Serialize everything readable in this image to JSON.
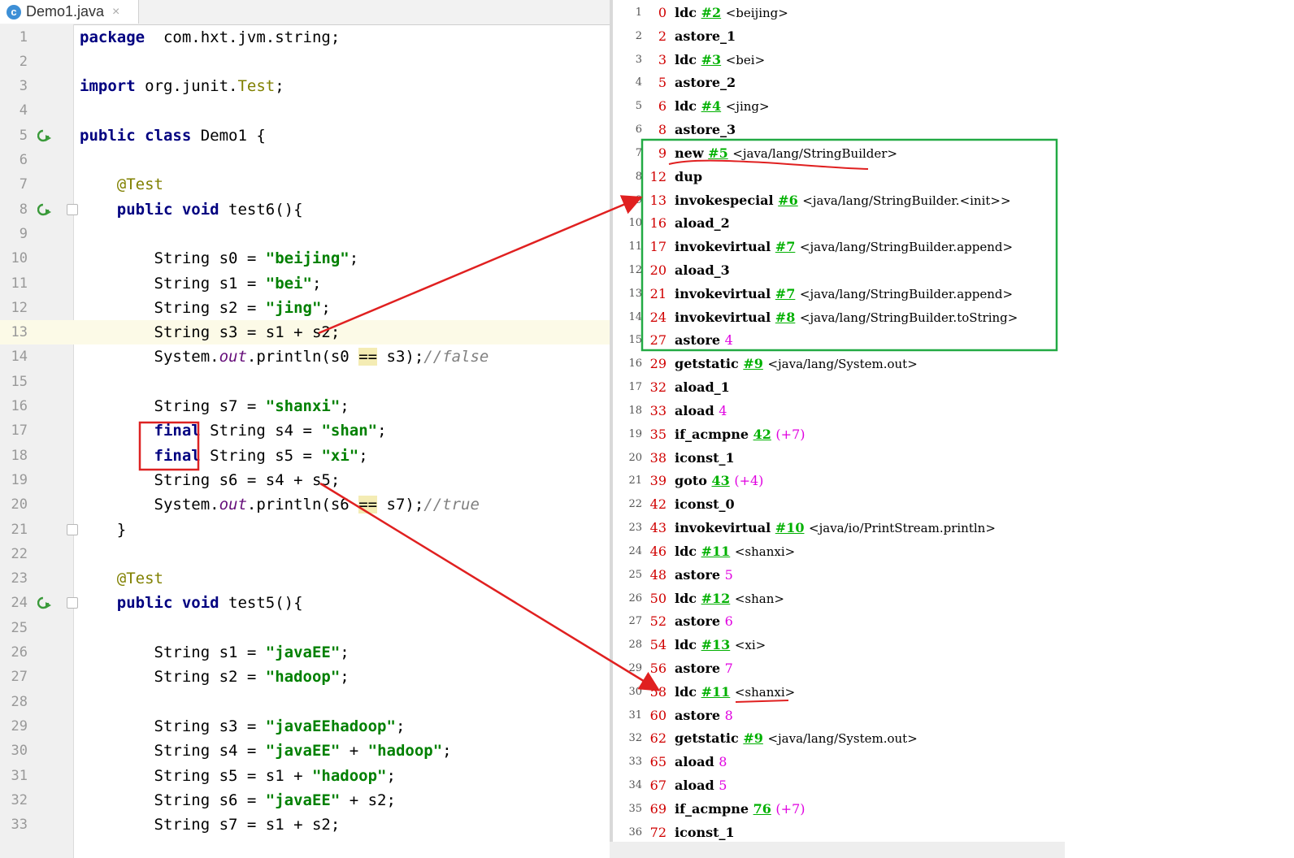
{
  "editor": {
    "tab": {
      "icon": "c",
      "filename": "Demo1.java",
      "close": "×"
    },
    "lines": [
      {
        "n": "1",
        "segs": [
          [
            "kw",
            "package"
          ],
          [
            "",
            "  com.hxt.jvm.string;"
          ]
        ]
      },
      {
        "n": "2",
        "segs": []
      },
      {
        "n": "3",
        "segs": [
          [
            "kw",
            "import"
          ],
          [
            "",
            " org.junit."
          ],
          [
            "ann",
            "Test"
          ],
          [
            "",
            ";"
          ]
        ]
      },
      {
        "n": "4",
        "segs": []
      },
      {
        "n": "5",
        "icon": "run",
        "segs": [
          [
            "kw",
            "public class"
          ],
          [
            "",
            " Demo1 {"
          ]
        ]
      },
      {
        "n": "6",
        "segs": []
      },
      {
        "n": "7",
        "segs": [
          [
            "",
            "    "
          ],
          [
            "ann",
            "@Test"
          ]
        ]
      },
      {
        "n": "8",
        "icon": "run",
        "fold": true,
        "segs": [
          [
            "",
            "    "
          ],
          [
            "kw",
            "public void"
          ],
          [
            "",
            " test6(){"
          ]
        ]
      },
      {
        "n": "9",
        "segs": []
      },
      {
        "n": "10",
        "segs": [
          [
            "",
            "        String s0 = "
          ],
          [
            "str",
            "\"beijing\""
          ],
          [
            "",
            ";"
          ]
        ]
      },
      {
        "n": "11",
        "segs": [
          [
            "",
            "        String s1 = "
          ],
          [
            "str",
            "\"bei\""
          ],
          [
            "",
            ";"
          ]
        ]
      },
      {
        "n": "12",
        "segs": [
          [
            "",
            "        String s2 = "
          ],
          [
            "str",
            "\"jing\""
          ],
          [
            "",
            ";"
          ]
        ]
      },
      {
        "n": "13",
        "hl": true,
        "segs": [
          [
            "",
            "        String s3 = s1 + s2;"
          ]
        ]
      },
      {
        "n": "14",
        "segs": [
          [
            "",
            "        System."
          ],
          [
            "fld",
            "out"
          ],
          [
            "",
            ".println(s0 "
          ],
          [
            "eqhl",
            "=="
          ],
          [
            "",
            " s3);"
          ],
          [
            "cmt",
            "//false"
          ]
        ]
      },
      {
        "n": "15",
        "segs": []
      },
      {
        "n": "16",
        "segs": [
          [
            "",
            "        String s7 = "
          ],
          [
            "str",
            "\"shanxi\""
          ],
          [
            "",
            ";"
          ]
        ]
      },
      {
        "n": "17",
        "segs": [
          [
            "",
            "        "
          ],
          [
            "kw",
            "final"
          ],
          [
            "",
            " String s4 = "
          ],
          [
            "str",
            "\"shan\""
          ],
          [
            "",
            ";"
          ]
        ]
      },
      {
        "n": "18",
        "segs": [
          [
            "",
            "        "
          ],
          [
            "kw",
            "final"
          ],
          [
            "",
            " String s5 = "
          ],
          [
            "str",
            "\"xi\""
          ],
          [
            "",
            ";"
          ]
        ]
      },
      {
        "n": "19",
        "segs": [
          [
            "",
            "        String s6 = s4 + s5;"
          ]
        ]
      },
      {
        "n": "20",
        "segs": [
          [
            "",
            "        System."
          ],
          [
            "fld",
            "out"
          ],
          [
            "",
            ".println(s6 "
          ],
          [
            "eqhl",
            "=="
          ],
          [
            "",
            " s7);"
          ],
          [
            "cmt",
            "//true"
          ]
        ]
      },
      {
        "n": "21",
        "fold": true,
        "segs": [
          [
            "",
            "    }"
          ]
        ]
      },
      {
        "n": "22",
        "segs": []
      },
      {
        "n": "23",
        "segs": [
          [
            "",
            "    "
          ],
          [
            "ann",
            "@Test"
          ]
        ]
      },
      {
        "n": "24",
        "icon": "run",
        "fold": true,
        "segs": [
          [
            "",
            "    "
          ],
          [
            "kw",
            "public void"
          ],
          [
            "",
            " test5(){"
          ]
        ]
      },
      {
        "n": "25",
        "segs": []
      },
      {
        "n": "26",
        "segs": [
          [
            "",
            "        String s1 = "
          ],
          [
            "str",
            "\"javaEE\""
          ],
          [
            "",
            ";"
          ]
        ]
      },
      {
        "n": "27",
        "segs": [
          [
            "",
            "        String s2 = "
          ],
          [
            "str",
            "\"hadoop\""
          ],
          [
            "",
            ";"
          ]
        ]
      },
      {
        "n": "28",
        "segs": []
      },
      {
        "n": "29",
        "segs": [
          [
            "",
            "        String s3 = "
          ],
          [
            "str",
            "\"javaEEhadoop\""
          ],
          [
            "",
            ";"
          ]
        ]
      },
      {
        "n": "30",
        "segs": [
          [
            "",
            "        String s4 = "
          ],
          [
            "str",
            "\"javaEE\""
          ],
          [
            "",
            " + "
          ],
          [
            "str",
            "\"hadoop\""
          ],
          [
            "",
            ";"
          ]
        ]
      },
      {
        "n": "31",
        "segs": [
          [
            "",
            "        String s5 = s1 + "
          ],
          [
            "str",
            "\"hadoop\""
          ],
          [
            "",
            ";"
          ]
        ]
      },
      {
        "n": "32",
        "segs": [
          [
            "",
            "        String s6 = "
          ],
          [
            "str",
            "\"javaEE\""
          ],
          [
            "",
            " + s2;"
          ]
        ]
      },
      {
        "n": "33",
        "segs": [
          [
            "",
            "        String s7 = s1 + s2;"
          ]
        ]
      }
    ]
  },
  "bytecode": {
    "lines": [
      {
        "n": "1",
        "off": "0",
        "op": "ldc",
        "ref": "#2",
        "cmt": "<beijing>"
      },
      {
        "n": "2",
        "off": "2",
        "op": "astore_1"
      },
      {
        "n": "3",
        "off": "3",
        "op": "ldc",
        "ref": "#3",
        "cmt": "<bei>"
      },
      {
        "n": "4",
        "off": "5",
        "op": "astore_2"
      },
      {
        "n": "5",
        "off": "6",
        "op": "ldc",
        "ref": "#4",
        "cmt": "<jing>"
      },
      {
        "n": "6",
        "off": "8",
        "op": "astore_3"
      },
      {
        "n": "7",
        "off": "9",
        "op": "new",
        "ref": "#5",
        "cmt": "<java/lang/StringBuilder>"
      },
      {
        "n": "8",
        "off": "12",
        "op": "dup"
      },
      {
        "n": "9",
        "off": "13",
        "op": "invokespecial",
        "ref": "#6",
        "cmt": "<java/lang/StringBuilder.<init>>"
      },
      {
        "n": "10",
        "off": "16",
        "op": "aload_2"
      },
      {
        "n": "11",
        "off": "17",
        "op": "invokevirtual",
        "ref": "#7",
        "cmt": "<java/lang/StringBuilder.append>"
      },
      {
        "n": "12",
        "off": "20",
        "op": "aload_3"
      },
      {
        "n": "13",
        "off": "21",
        "op": "invokevirtual",
        "ref": "#7",
        "cmt": "<java/lang/StringBuilder.append>"
      },
      {
        "n": "14",
        "off": "24",
        "op": "invokevirtual",
        "ref": "#8",
        "cmt": "<java/lang/StringBuilder.toString>"
      },
      {
        "n": "15",
        "off": "27",
        "op": "astore",
        "mag": "4"
      },
      {
        "n": "16",
        "off": "29",
        "op": "getstatic",
        "ref": "#9",
        "cmt": "<java/lang/System.out>"
      },
      {
        "n": "17",
        "off": "32",
        "op": "aload_1"
      },
      {
        "n": "18",
        "off": "33",
        "op": "aload",
        "mag": "4"
      },
      {
        "n": "19",
        "off": "35",
        "op": "if_acmpne",
        "ref": "42",
        "mag": "(+7)"
      },
      {
        "n": "20",
        "off": "38",
        "op": "iconst_1"
      },
      {
        "n": "21",
        "off": "39",
        "op": "goto",
        "ref": "43",
        "mag": "(+4)"
      },
      {
        "n": "22",
        "off": "42",
        "op": "iconst_0"
      },
      {
        "n": "23",
        "off": "43",
        "op": "invokevirtual",
        "ref": "#10",
        "cmt": "<java/io/PrintStream.println>"
      },
      {
        "n": "24",
        "off": "46",
        "op": "ldc",
        "ref": "#11",
        "cmt": "<shanxi>"
      },
      {
        "n": "25",
        "off": "48",
        "op": "astore",
        "mag": "5"
      },
      {
        "n": "26",
        "off": "50",
        "op": "ldc",
        "ref": "#12",
        "cmt": "<shan>"
      },
      {
        "n": "27",
        "off": "52",
        "op": "astore",
        "mag": "6"
      },
      {
        "n": "28",
        "off": "54",
        "op": "ldc",
        "ref": "#13",
        "cmt": "<xi>"
      },
      {
        "n": "29",
        "off": "56",
        "op": "astore",
        "mag": "7"
      },
      {
        "n": "30",
        "off": "58",
        "op": "ldc",
        "ref": "#11",
        "cmt": "<shanxi>"
      },
      {
        "n": "31",
        "off": "60",
        "op": "astore",
        "mag": "8"
      },
      {
        "n": "32",
        "off": "62",
        "op": "getstatic",
        "ref": "#9",
        "cmt": "<java/lang/System.out>"
      },
      {
        "n": "33",
        "off": "65",
        "op": "aload",
        "mag": "8"
      },
      {
        "n": "34",
        "off": "67",
        "op": "aload",
        "mag": "5"
      },
      {
        "n": "35",
        "off": "69",
        "op": "if_acmpne",
        "ref": "76",
        "mag": "(+7)"
      },
      {
        "n": "36",
        "off": "72",
        "op": "iconst_1"
      }
    ]
  },
  "colors": {
    "keyword": "#000080",
    "string": "#008000",
    "annotation": "#808000",
    "offset": "#d00000",
    "ref": "#00b000",
    "local": "#e000e0",
    "arrow": "#e02020",
    "highlight_box": "#22aa44",
    "final_box": "#dd2222"
  }
}
